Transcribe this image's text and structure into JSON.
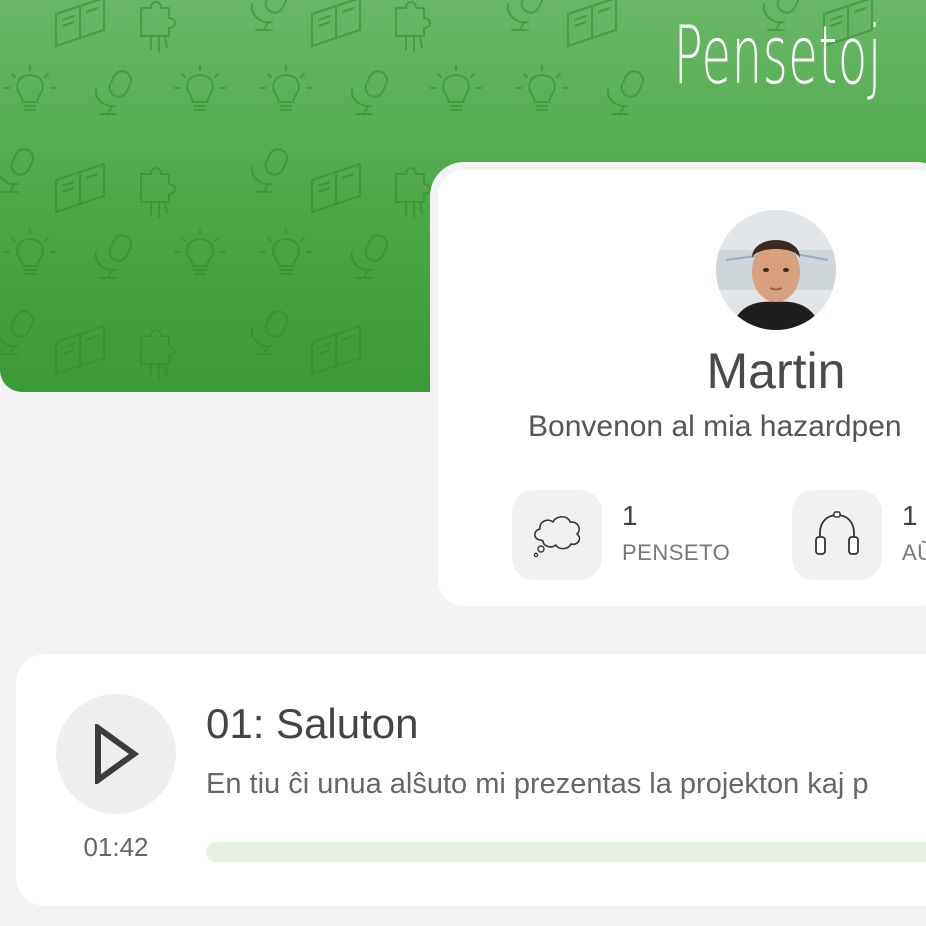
{
  "header": {
    "brand": "Pensetoj",
    "pattern_icons": [
      "lightbulb-icon",
      "microphone-icon",
      "book-icon",
      "puzzle-hand-icon"
    ]
  },
  "profile": {
    "name": "Martin",
    "tagline": "Bonvenon al mia hazardpen",
    "stats": [
      {
        "icon": "thought-cloud-icon",
        "count": "1",
        "label": "PENSETO"
      },
      {
        "icon": "headphones-icon",
        "count": "1",
        "label": "AŬ"
      }
    ]
  },
  "episode": {
    "title": "01: Saluton",
    "description": "En tiu ĉi unua alŝuto mi prezentas la projekton kaj p",
    "duration": "01:42",
    "progress": 0
  },
  "colors": {
    "brand_green": "#4ea84a",
    "background": "#f3f3f3",
    "card": "#ffffff",
    "progress_track": "#e6f1e4"
  }
}
